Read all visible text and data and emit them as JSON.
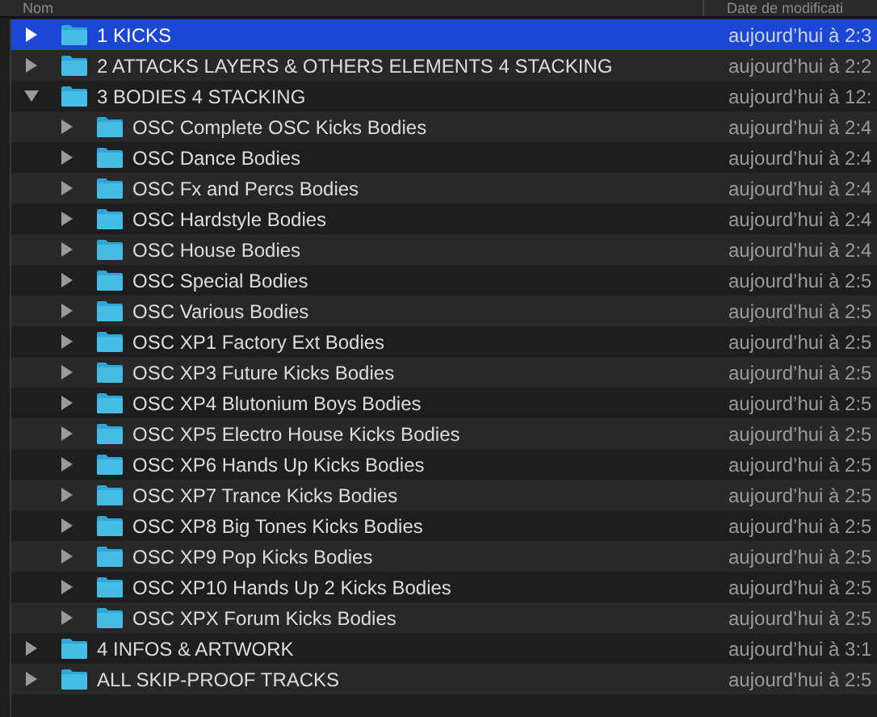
{
  "columns": [
    {
      "label": "Nom"
    },
    {
      "label": "Date de modificati"
    }
  ],
  "items": [
    {
      "name": "1 KICKS",
      "date": "aujourd’hui à 2:3",
      "selected": true,
      "expanded": false
    },
    {
      "name": "2 ATTACKS LAYERS & OTHERS ELEMENTS 4 STACKING",
      "date": "aujourd’hui à 2:2",
      "selected": false,
      "expanded": false
    },
    {
      "name": "3 BODIES 4 STACKING",
      "date": "aujourd’hui à 12:",
      "selected": false,
      "expanded": true,
      "children": [
        {
          "name": "OSC Complete OSC Kicks Bodies",
          "date": "aujourd’hui à 2:4",
          "selected": false,
          "expanded": false
        },
        {
          "name": "OSC Dance Bodies",
          "date": "aujourd’hui à 2:4",
          "selected": false,
          "expanded": false
        },
        {
          "name": "OSC Fx and Percs Bodies",
          "date": "aujourd’hui à 2:4",
          "selected": false,
          "expanded": false
        },
        {
          "name": "OSC Hardstyle Bodies",
          "date": "aujourd’hui à 2:4",
          "selected": false,
          "expanded": false
        },
        {
          "name": "OSC House Bodies",
          "date": "aujourd’hui à 2:4",
          "selected": false,
          "expanded": false
        },
        {
          "name": "OSC Special Bodies",
          "date": "aujourd’hui à 2:5",
          "selected": false,
          "expanded": false
        },
        {
          "name": "OSC Various Bodies",
          "date": "aujourd’hui à 2:5",
          "selected": false,
          "expanded": false
        },
        {
          "name": "OSC XP1 Factory Ext Bodies",
          "date": "aujourd’hui à 2:5",
          "selected": false,
          "expanded": false
        },
        {
          "name": "OSC XP3 Future Kicks Bodies",
          "date": "aujourd’hui à 2:5",
          "selected": false,
          "expanded": false
        },
        {
          "name": "OSC XP4 Blutonium Boys Bodies",
          "date": "aujourd’hui à 2:5",
          "selected": false,
          "expanded": false
        },
        {
          "name": "OSC XP5 Electro House Kicks Bodies",
          "date": "aujourd’hui à 2:5",
          "selected": false,
          "expanded": false
        },
        {
          "name": "OSC XP6 Hands Up Kicks Bodies",
          "date": "aujourd’hui à 2:5",
          "selected": false,
          "expanded": false
        },
        {
          "name": "OSC XP7 Trance Kicks Bodies",
          "date": "aujourd’hui à 2:5",
          "selected": false,
          "expanded": false
        },
        {
          "name": "OSC XP8 Big Tones Kicks Bodies",
          "date": "aujourd’hui à 2:5",
          "selected": false,
          "expanded": false
        },
        {
          "name": "OSC XP9 Pop Kicks Bodies",
          "date": "aujourd’hui à 2:5",
          "selected": false,
          "expanded": false
        },
        {
          "name": "OSC XP10 Hands Up 2 Kicks Bodies",
          "date": "aujourd’hui à 2:5",
          "selected": false,
          "expanded": false
        },
        {
          "name": "OSC XPX Forum Kicks Bodies",
          "date": "aujourd’hui à 2:5",
          "selected": false,
          "expanded": false
        }
      ]
    },
    {
      "name": "4 INFOS & ARTWORK",
      "date": "aujourd’hui à 3:1",
      "selected": false,
      "expanded": false
    },
    {
      "name": "ALL SKIP-PROOF TRACKS",
      "date": "aujourd’hui à 2:5",
      "selected": false,
      "expanded": false
    }
  ]
}
